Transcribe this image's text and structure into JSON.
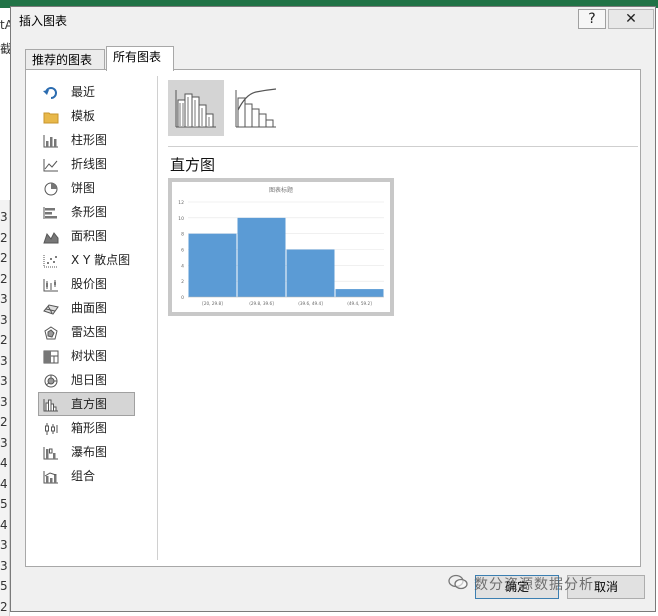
{
  "window": {
    "title": "插入图表",
    "help_label": "?",
    "close_label": "✕"
  },
  "tabs": [
    {
      "label": "推荐的图表"
    },
    {
      "label": "所有图表"
    }
  ],
  "categories": [
    {
      "label": "最近",
      "icon": "recent-icon"
    },
    {
      "label": "模板",
      "icon": "folder-icon"
    },
    {
      "label": "柱形图",
      "icon": "column-chart-icon"
    },
    {
      "label": "折线图",
      "icon": "line-chart-icon"
    },
    {
      "label": "饼图",
      "icon": "pie-chart-icon"
    },
    {
      "label": "条形图",
      "icon": "bar-chart-icon"
    },
    {
      "label": "面积图",
      "icon": "area-chart-icon"
    },
    {
      "label": "X Y 散点图",
      "icon": "scatter-chart-icon"
    },
    {
      "label": "股价图",
      "icon": "stock-chart-icon"
    },
    {
      "label": "曲面图",
      "icon": "surface-chart-icon"
    },
    {
      "label": "雷达图",
      "icon": "radar-chart-icon"
    },
    {
      "label": "树状图",
      "icon": "treemap-chart-icon"
    },
    {
      "label": "旭日图",
      "icon": "sunburst-chart-icon"
    },
    {
      "label": "直方图",
      "icon": "histogram-chart-icon"
    },
    {
      "label": "箱形图",
      "icon": "boxplot-chart-icon"
    },
    {
      "label": "瀑布图",
      "icon": "waterfall-chart-icon"
    },
    {
      "label": "组合",
      "icon": "combo-chart-icon"
    }
  ],
  "selected_category": "直方图",
  "subtypes": [
    {
      "icon": "histogram-subtype-icon",
      "selected": true
    },
    {
      "icon": "pareto-subtype-icon",
      "selected": false
    }
  ],
  "type_title": "直方图",
  "chart_data": {
    "type": "bar",
    "title": "图表标题",
    "categories": [
      "[20, 29.8]",
      "(29.8, 39.6]",
      "(39.6, 49.4]",
      "(49.4, 59.2]"
    ],
    "values": [
      8,
      10,
      6,
      1
    ],
    "yticks": [
      "0",
      "2",
      "4",
      "6",
      "8",
      "10",
      "12"
    ],
    "ylim": [
      0,
      12
    ],
    "grid": true,
    "bar_color": "#5b9bd5"
  },
  "buttons": {
    "ok": "确定",
    "cancel": "取消"
  },
  "watermark": "数分资源数据分析",
  "background": {
    "row_numbers": [
      "3",
      "2",
      "2",
      "2",
      "3",
      "3",
      "2",
      "3",
      "3",
      "3",
      "2",
      "3",
      "4",
      "4",
      "5",
      "4",
      "3",
      "3",
      "5",
      "2"
    ],
    "fragments": [
      "tA",
      "截"
    ]
  },
  "colors": {
    "accent": "#217346",
    "selection": "#d5d5d5"
  }
}
